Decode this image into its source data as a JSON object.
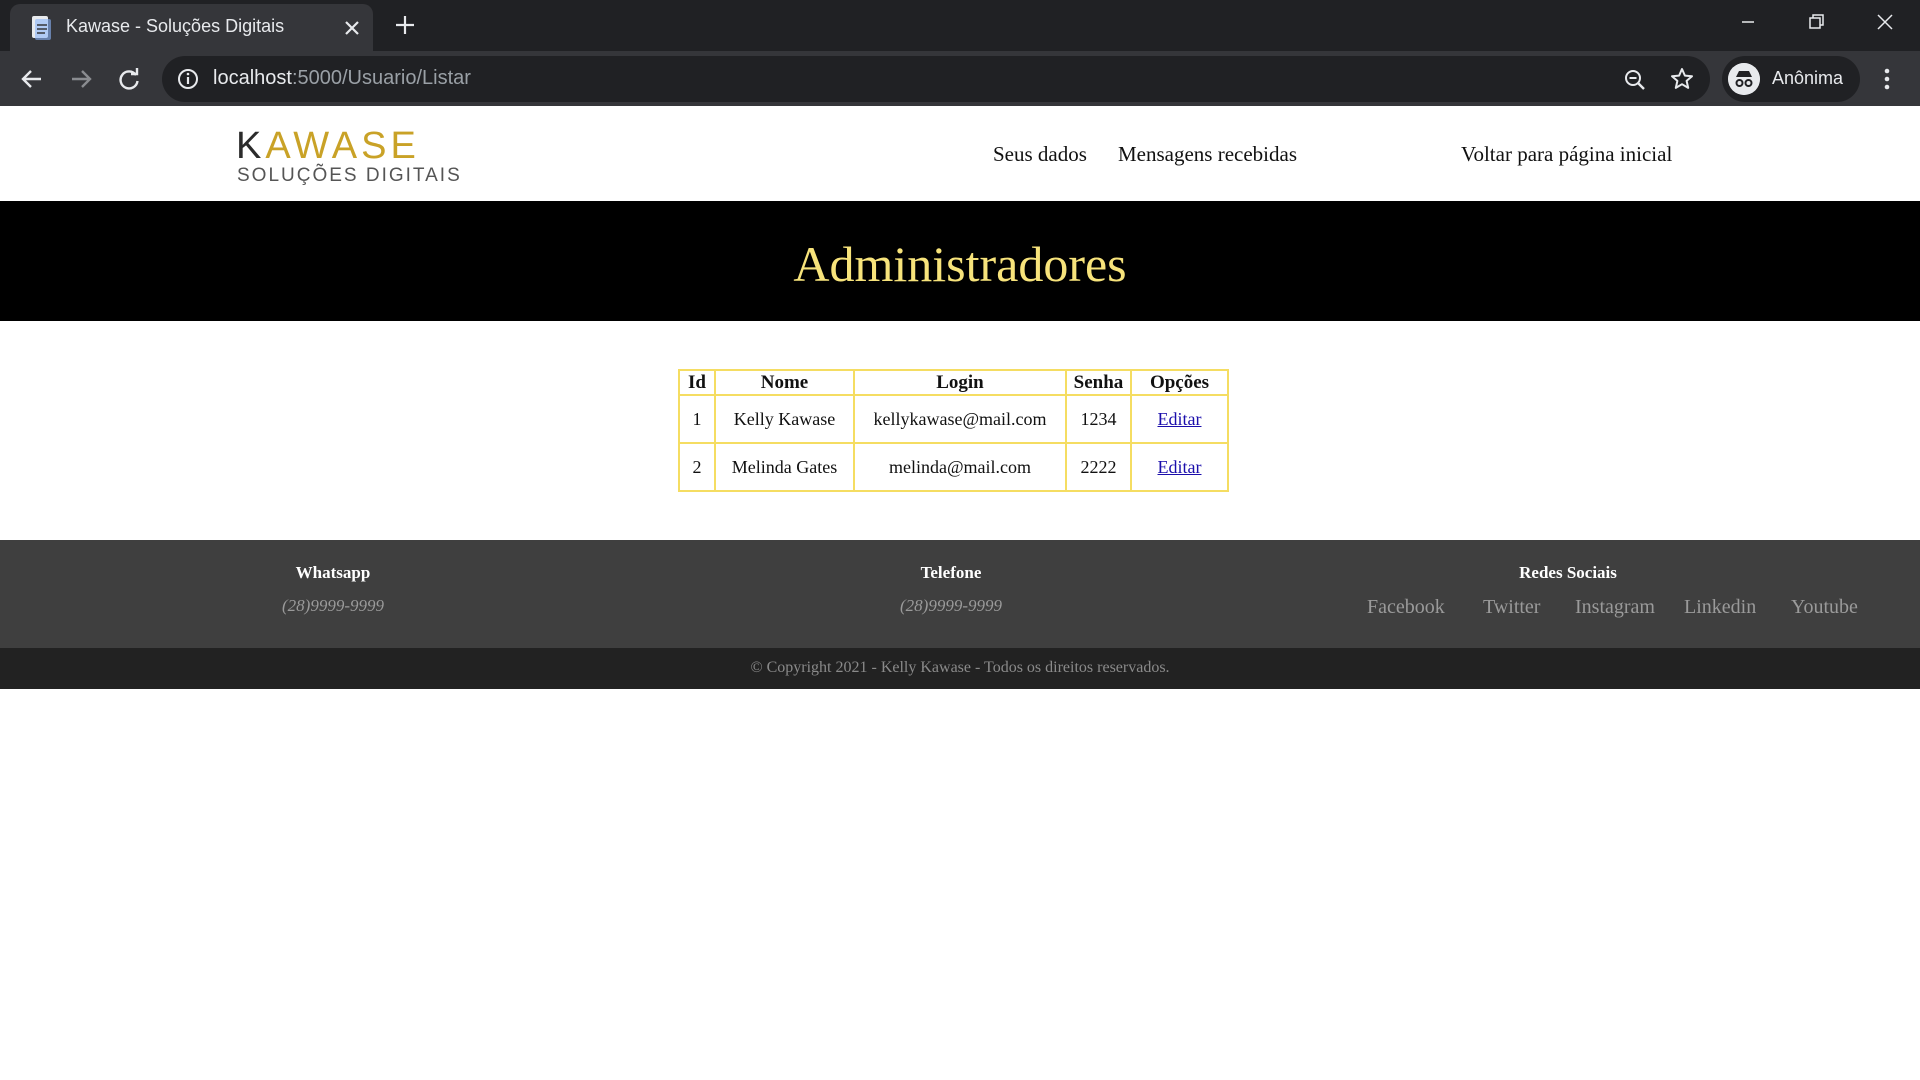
{
  "browser": {
    "tab_title": "Kawase - Soluções Digitais",
    "url_host": "localhost",
    "url_path": ":5000/Usuario/Listar",
    "profile_name": "Anônima"
  },
  "header": {
    "logo_main": "AWASE",
    "logo_k": "K",
    "logo_sub": "SOLUÇÕES DIGITAIS",
    "nav": {
      "seus_dados": "Seus dados",
      "mensagens": "Mensagens recebidas",
      "voltar": "Voltar para página inicial"
    }
  },
  "banner": {
    "title": "Administradores"
  },
  "table": {
    "headers": [
      "Id",
      "Nome",
      "Login",
      "Senha",
      "Opções"
    ],
    "rows": [
      {
        "id": "1",
        "nome": "Kelly Kawase",
        "login": "kellykawase@mail.com",
        "senha": "1234",
        "opcao": "Editar"
      },
      {
        "id": "2",
        "nome": "Melinda Gates",
        "login": "melinda@mail.com",
        "senha": "2222",
        "opcao": "Editar"
      }
    ]
  },
  "footer": {
    "whatsapp_label": "Whatsapp",
    "whatsapp_value": "(28)9999-9999",
    "telefone_label": "Telefone",
    "telefone_value": "(28)9999-9999",
    "redes_label": "Redes Sociais",
    "social": [
      "Facebook",
      "Twitter",
      "Instagram",
      "Linkedin",
      "Youtube"
    ],
    "copyright": "© Copyright 2021 - Kelly Kawase - Todos os direitos reservados."
  },
  "colors": {
    "banner_bg": "#000000",
    "banner_text": "#f7e37b",
    "table_border": "#f5dd62",
    "footer_bg": "#3f3f3f",
    "copyright_bg": "#222222",
    "brand_gold": "#c9a227"
  }
}
